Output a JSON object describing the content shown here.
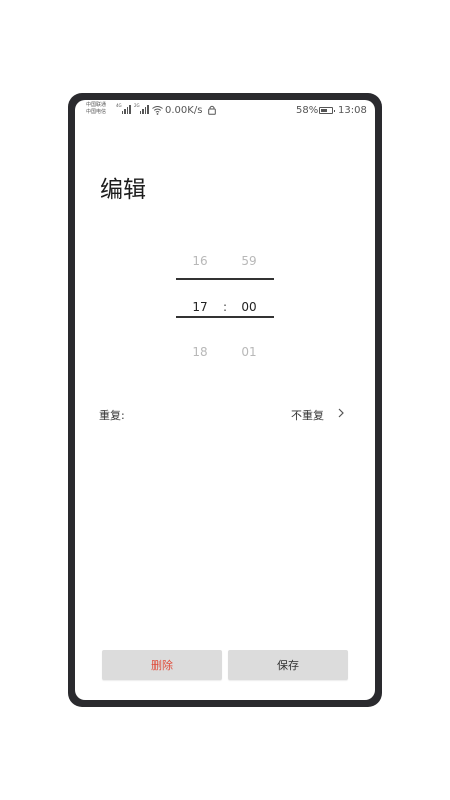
{
  "status_bar": {
    "carrier_1": "中国联通",
    "carrier_2": "中国电信",
    "signal_1_tag": "4G",
    "signal_2_tag": "2G",
    "net_speed": "0.00K/s",
    "battery_percent": "58%",
    "time": "13:08",
    "battery_level": 0.58
  },
  "page": {
    "title": "编辑"
  },
  "time_picker": {
    "hour_prev": "16",
    "hour_selected": "17",
    "hour_next": "18",
    "separator": ":",
    "minute_prev": "59",
    "minute_selected": "00",
    "minute_next": "01"
  },
  "repeat": {
    "label": "重复:",
    "value": "不重复"
  },
  "buttons": {
    "delete_label": "删除",
    "save_label": "保存"
  },
  "colors": {
    "delete_text": "#e04b3a",
    "button_bg": "#dcdcdc",
    "phone_frame": "#2a2a2e"
  }
}
